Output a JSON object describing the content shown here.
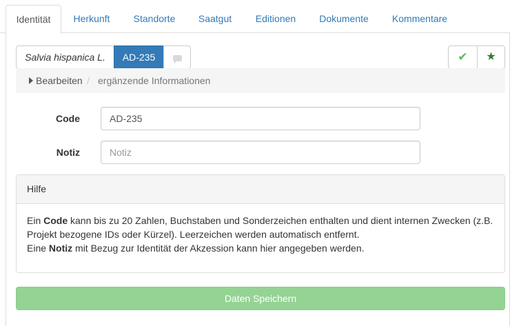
{
  "tabs": [
    {
      "label": "Identität",
      "active": true
    },
    {
      "label": "Herkunft",
      "active": false
    },
    {
      "label": "Standorte",
      "active": false
    },
    {
      "label": "Saatgut",
      "active": false
    },
    {
      "label": "Editionen",
      "active": false
    },
    {
      "label": "Dokumente",
      "active": false
    },
    {
      "label": "Kommentare",
      "active": false
    }
  ],
  "toolbar": {
    "species": "Salvia hispanica L.",
    "code": "AD-235",
    "comment_icon": "comment-icon",
    "check_icon": "check-icon",
    "check_glyph": "✔",
    "star_icon": "star-icon",
    "star_glyph": "★"
  },
  "breadcrumb": {
    "edit": "Bearbeiten",
    "separator": "/",
    "extra": "ergänzende Informationen"
  },
  "form": {
    "code_label": "Code",
    "code_value": "AD-235",
    "notiz_label": "Notiz",
    "notiz_placeholder": "Notiz"
  },
  "help": {
    "title": "Hilfe",
    "line1_pre": "Ein ",
    "line1_bold": "Code",
    "line1_post": " kann bis zu 20 Zahlen, Buchstaben und Sonderzeichen enthalten und dient internen Zwecken (z.B. Projekt bezogene IDs oder Kürzel). Leerzeichen werden automatisch entfernt.",
    "line2_pre": "Eine ",
    "line2_bold": "Notiz",
    "line2_post": " mit Bezug zur Identität der Akzession kann hier angegeben werden."
  },
  "save_label": "Daten Speichern",
  "colors": {
    "primary": "#337ab7",
    "success_disabled": "#94d394",
    "check": "#5cb85c",
    "star": "#2f7d32"
  }
}
